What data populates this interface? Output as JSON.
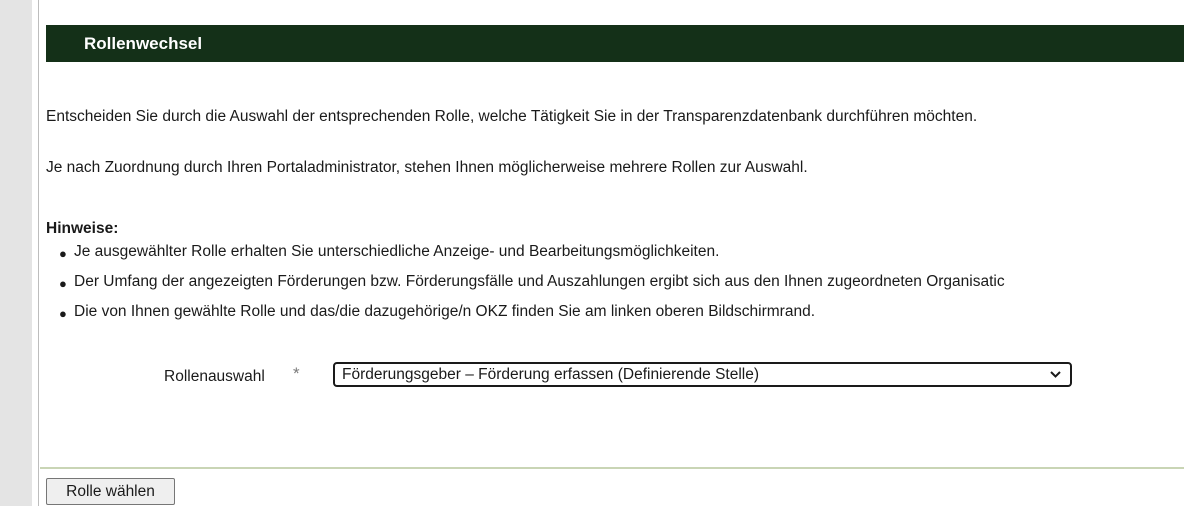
{
  "panel": {
    "title": "Rollenwechsel"
  },
  "intro": {
    "line1": "Entscheiden Sie durch die Auswahl der entsprechenden Rolle, welche Tätigkeit Sie in der Transparenzdatenbank durchführen möchten.",
    "line2": "Je nach Zuordnung durch Ihren Portaladministrator, stehen Ihnen möglicherweise mehrere Rollen zur Auswahl."
  },
  "hints": {
    "title": "Hinweise:",
    "items": [
      "Je ausgewählter Rolle erhalten Sie unterschiedliche Anzeige- und Bearbeitungsmöglichkeiten.",
      "Der Umfang der angezeigten Förderungen bzw. Förderungsfälle und Auszahlungen ergibt sich aus den Ihnen zugeordneten Organisatic",
      "Die von Ihnen gewählte Rolle und das/die dazugehörige/n OKZ finden Sie am linken oberen Bildschirmrand."
    ]
  },
  "role_select": {
    "label": "Rollenauswahl",
    "required_marker": "*",
    "selected_value": "Förderungsgeber – Förderung erfassen (Definierende Stelle)",
    "icon": "chevron-down-icon"
  },
  "actions": {
    "submit_label": "Rolle wählen"
  },
  "colors": {
    "header_bg": "#143018",
    "header_text": "#ffffff",
    "divider": "#c9d5b5",
    "left_rail": "#e4e4e4"
  }
}
